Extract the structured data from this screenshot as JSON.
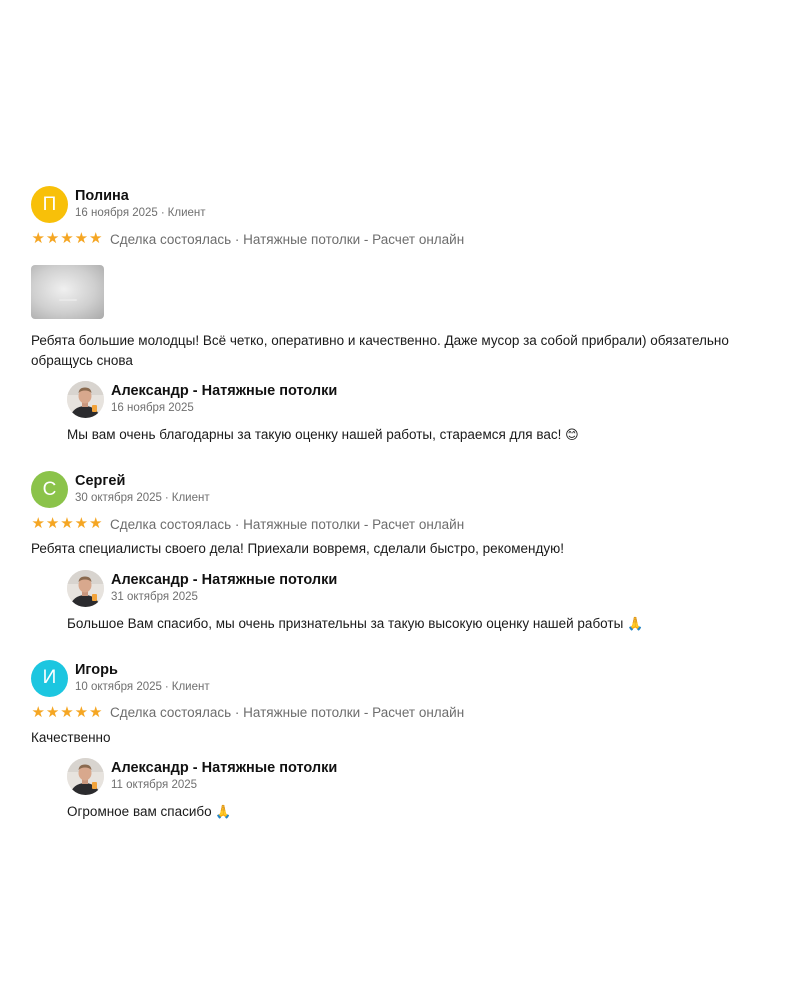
{
  "colors": {
    "star": "#f5a623",
    "avatar_polina": "#f8c009",
    "avatar_sergey": "#8bc34a",
    "avatar_igor": "#1cc6e0"
  },
  "reviews": [
    {
      "initial": "П",
      "name": "Полина",
      "date": "16 ноября 2025",
      "role": "Клиент",
      "rating": 5,
      "deal": "Сделка состоялась · Натяжные потолки - Расчет онлайн",
      "has_photo": true,
      "text": "Ребята большие молодцы! Всё четко, оперативно и качественно. Даже мусор за собой прибрали) обязательно обращусь снова",
      "reply": {
        "name": "Александр - Натяжные потолки",
        "date": "16 ноября 2025",
        "text": "Мы вам очень благодарны за такую оценку нашей работы, стараемся для вас!",
        "emoji": "😊"
      }
    },
    {
      "initial": "С",
      "name": "Сергей",
      "date": "30 октября 2025",
      "role": "Клиент",
      "rating": 5,
      "deal": "Сделка состоялась · Натяжные потолки - Расчет онлайн",
      "has_photo": false,
      "text": "Ребята специалисты своего дела! Приехали вовремя, сделали быстро, рекомендую!",
      "reply": {
        "name": "Александр - Натяжные потолки",
        "date": "31 октября 2025",
        "text": "Большое Вам спасибо, мы очень признательны за такую высокую оценку нашей работы",
        "emoji": "🙏"
      }
    },
    {
      "initial": "И",
      "name": "Игорь",
      "date": "10 октября 2025",
      "role": "Клиент",
      "rating": 5,
      "deal": "Сделка состоялась · Натяжные потолки - Расчет онлайн",
      "has_photo": false,
      "text": "Качественно",
      "reply": {
        "name": "Александр - Натяжные потолки",
        "date": "11 октября 2025",
        "text": "Огромное вам спасибо",
        "emoji": "🙏"
      }
    }
  ],
  "icons": {
    "star": "star-icon",
    "reply_avatar": "owner-avatar"
  }
}
